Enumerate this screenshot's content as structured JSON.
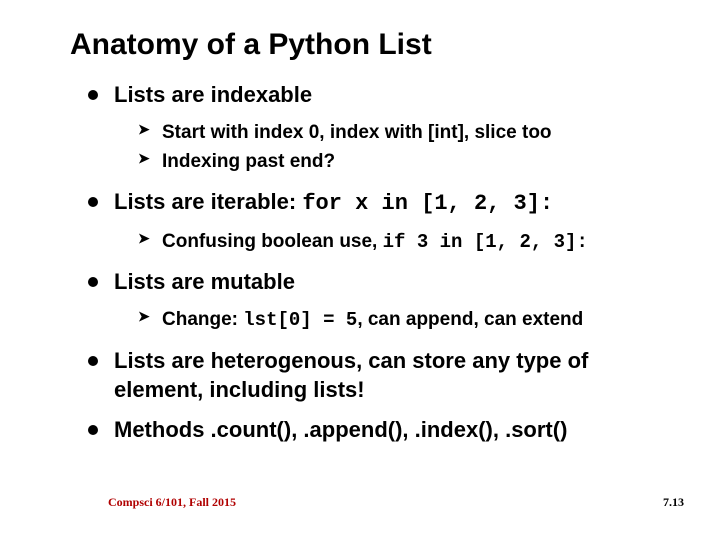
{
  "title": "Anatomy of a Python List",
  "bullets": {
    "b0": {
      "text": "Lists are indexable",
      "sub": {
        "s0": "Start with index 0, index with [int], slice too",
        "s1": "Indexing past end?"
      }
    },
    "b1": {
      "lead": "Lists are iterable: ",
      "code": "for x in [1, 2, 3]:",
      "sub": {
        "s0_lead": "Confusing boolean use, ",
        "s0_code": "if 3 in [1, 2, 3]:"
      }
    },
    "b2": {
      "text": "Lists are mutable",
      "sub": {
        "s0_lead": "Change: ",
        "s0_code": "lst[0] = 5",
        "s0_tail": ", can append, can extend"
      }
    },
    "b3": {
      "text": "Lists are heterogenous, can store any type of element, including lists!"
    },
    "b4": {
      "text": "Methods .count(), .append(), .index(), .sort()"
    }
  },
  "footer": {
    "left": "Compsci 6/101, Fall 2015",
    "right": "7.13"
  }
}
